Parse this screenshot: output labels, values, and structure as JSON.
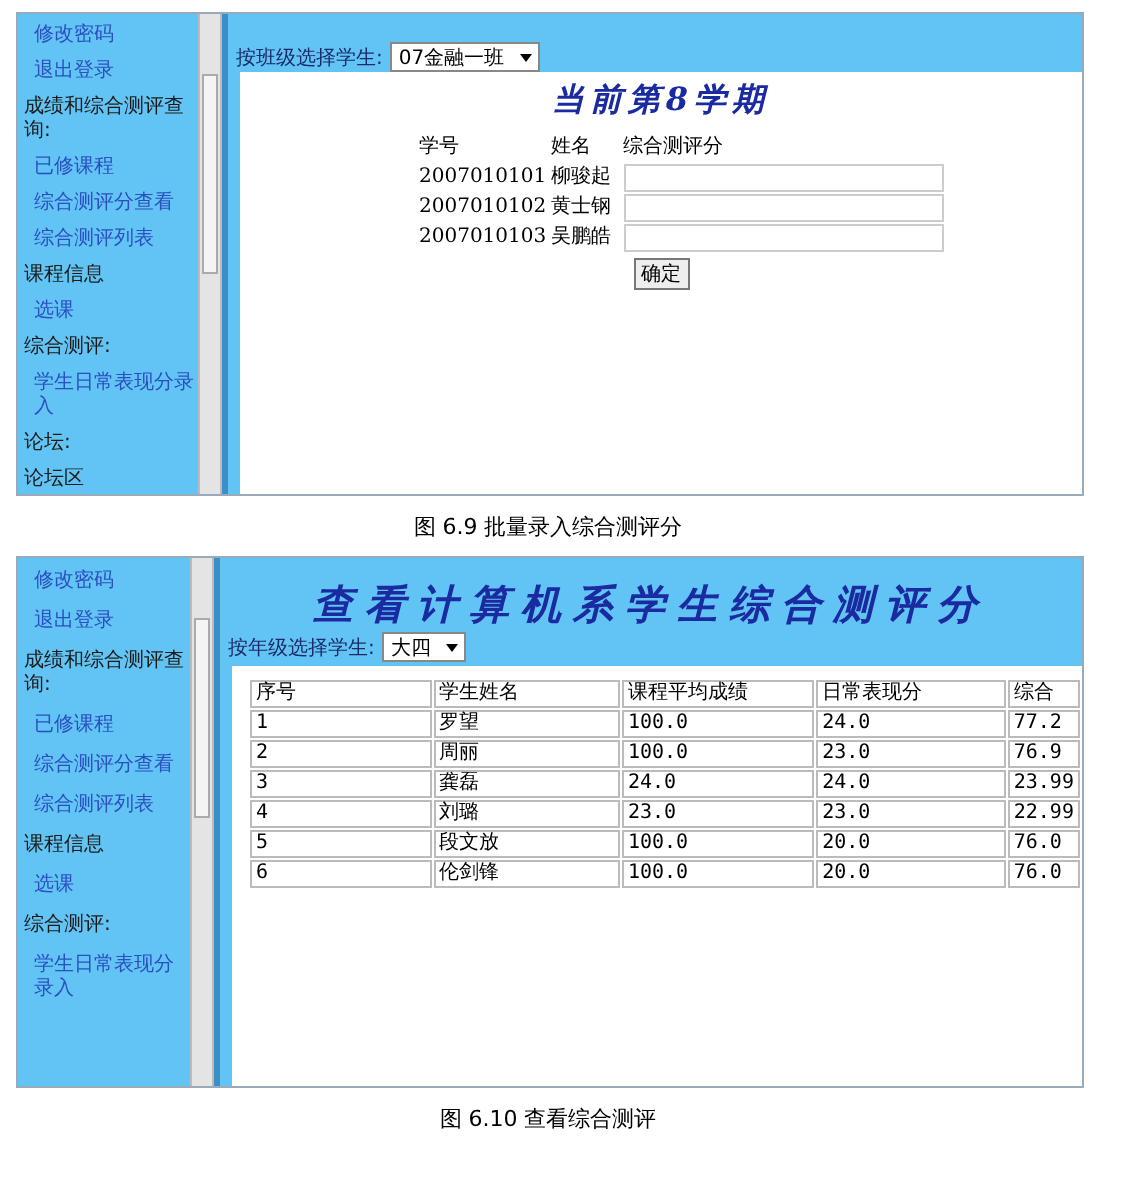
{
  "figures": [
    {
      "kind": "form",
      "caption": "图 6.9 批量录入综合测评分",
      "sidebar": {
        "items": [
          {
            "text": "修改密码",
            "kind": "link"
          },
          {
            "text": "退出登录",
            "kind": "link"
          },
          {
            "text": "成绩和综合测评查询:",
            "kind": "heading"
          },
          {
            "text": "已修课程",
            "kind": "link"
          },
          {
            "text": "综合测评分查看",
            "kind": "link"
          },
          {
            "text": "综合测评列表",
            "kind": "link"
          },
          {
            "text": "课程信息",
            "kind": "heading"
          },
          {
            "text": "选课",
            "kind": "link"
          },
          {
            "text": "综合测评:",
            "kind": "heading"
          },
          {
            "text": "学生日常表现分录入",
            "kind": "link"
          },
          {
            "text": "论坛:",
            "kind": "heading"
          },
          {
            "text": "论坛区",
            "kind": "heading"
          }
        ]
      },
      "filter": {
        "label": "按班级选择学生:",
        "value": "07金融一班"
      },
      "title": "当前第8学期",
      "form": {
        "columns": [
          "学号",
          "姓名",
          "综合测评分"
        ],
        "rows": [
          {
            "id": "2007010101",
            "name": "柳骏起"
          },
          {
            "id": "2007010102",
            "name": "黄士钢"
          },
          {
            "id": "2007010103",
            "name": "吴鹏皓"
          }
        ],
        "submit": "确定"
      }
    },
    {
      "kind": "table",
      "caption": "图 6.10   查看综合测评",
      "sidebar": {
        "items": [
          {
            "text": "修改密码",
            "kind": "link"
          },
          {
            "text": "退出登录",
            "kind": "link"
          },
          {
            "text": "成绩和综合测评查询:",
            "kind": "heading"
          },
          {
            "text": "已修课程",
            "kind": "link"
          },
          {
            "text": "综合测评分查看",
            "kind": "link"
          },
          {
            "text": "综合测评列表",
            "kind": "link"
          },
          {
            "text": "课程信息",
            "kind": "heading"
          },
          {
            "text": "选课",
            "kind": "link"
          },
          {
            "text": "综合测评:",
            "kind": "heading"
          },
          {
            "text": "学生日常表现分录入",
            "kind": "link"
          }
        ]
      },
      "title": "查看计算机系学生综合测评分",
      "filter": {
        "label": "按年级选择学生:",
        "value": "大四"
      },
      "table": {
        "columns": [
          "序号",
          "学生姓名",
          "课程平均成绩",
          "日常表现分",
          "综合"
        ],
        "rows": [
          [
            "1",
            "罗望",
            "100.0",
            "24.0",
            "77.2"
          ],
          [
            "2",
            "周丽",
            "100.0",
            "23.0",
            "76.9"
          ],
          [
            "3",
            "龚磊",
            "24.0",
            "24.0",
            "23.99"
          ],
          [
            "4",
            "刘璐",
            "23.0",
            "23.0",
            "22.99"
          ],
          [
            "5",
            "段文放",
            "100.0",
            "20.0",
            "76.0"
          ],
          [
            "6",
            "伦剑锋",
            "100.0",
            "20.0",
            "76.0"
          ]
        ]
      }
    }
  ]
}
